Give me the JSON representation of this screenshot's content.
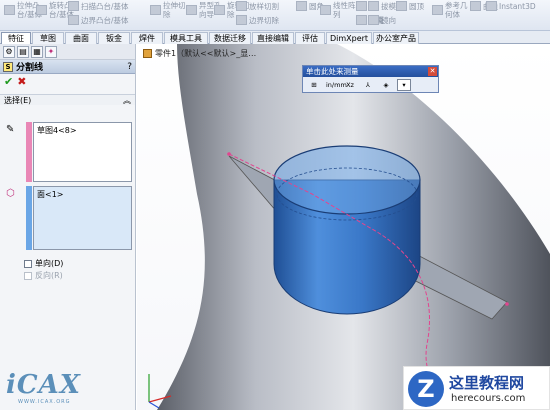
{
  "ribbon": {
    "items": [
      {
        "label": "拉伸凸\n台/基体",
        "icon": "extrude-boss-icon"
      },
      {
        "label": "旋转凸\n台/基体",
        "icon": "revolve-boss-icon"
      },
      {
        "label": "扫描凸台/基体",
        "icon": "sweep-boss-icon"
      },
      {
        "label": "边界凸台/基体",
        "icon": "boundary-boss-icon"
      },
      {
        "label": "拉伸切\n除",
        "icon": "extruded-cut-icon"
      },
      {
        "label": "异型孔\n向导",
        "icon": "hole-wizard-icon"
      },
      {
        "label": "旋转切\n除",
        "icon": "revolved-cut-icon"
      },
      {
        "label": "放样切割",
        "icon": "loft-cut-icon"
      },
      {
        "label": "边界切除",
        "icon": "boundary-cut-icon"
      },
      {
        "label": "圆角",
        "icon": "fillet-icon"
      },
      {
        "label": "线性阵\n列",
        "icon": "linear-pattern-icon"
      },
      {
        "label": "筋",
        "icon": "rib-icon"
      },
      {
        "label": "抽壳",
        "icon": "shell-icon"
      },
      {
        "label": "拔模",
        "icon": "draft-icon"
      },
      {
        "label": "包覆",
        "icon": "wrap-icon"
      },
      {
        "label": "圆顶",
        "icon": "dome-icon"
      },
      {
        "label": "镜向",
        "icon": "mirror-icon"
      },
      {
        "label": "参考几\n何体",
        "icon": "reference-geometry-icon"
      },
      {
        "label": "曲线",
        "icon": "curves-icon"
      },
      {
        "label": "Instant3D",
        "icon": "instant3d-icon"
      }
    ]
  },
  "tabs": [
    "特征",
    "草图",
    "曲面",
    "钣金",
    "焊件",
    "模具工具",
    "数据迁移",
    "直接编辑",
    "评估",
    "DimXpert",
    "办公室产品"
  ],
  "active_tab": "特征",
  "property_manager": {
    "title": "分割线",
    "help": "?",
    "ok": "✔",
    "cancel": "✖",
    "selection_group": "选择(E)",
    "collapse": "︽",
    "sketch_item": "草图4<8>",
    "face_item": "面<1>",
    "single_direction": "单向(D)",
    "reverse_direction": "反向(R)"
  },
  "viewport": {
    "part_name": "零件1（默认<<默认>_显…"
  },
  "measure_toolbar": {
    "title": "单击此处来测量",
    "close": "✕",
    "buttons": [
      "⊞",
      "in/mm",
      "Xz",
      "⅄",
      "◈",
      "▾"
    ]
  },
  "watermarks": {
    "left_logo": "iCAX",
    "left_sub": "WWW.ICAX.ORG",
    "badge_mark": "Z",
    "badge_name": "这里教程网",
    "badge_url": "herecours.com"
  },
  "colors": {
    "cylinder": "#3e7fcf",
    "sketch_line": "#e2458f",
    "selection_sketch_bar": "#e987b6",
    "selection_face_bar": "#6aa6e6",
    "face_box_bg": "#d9e8f8"
  }
}
